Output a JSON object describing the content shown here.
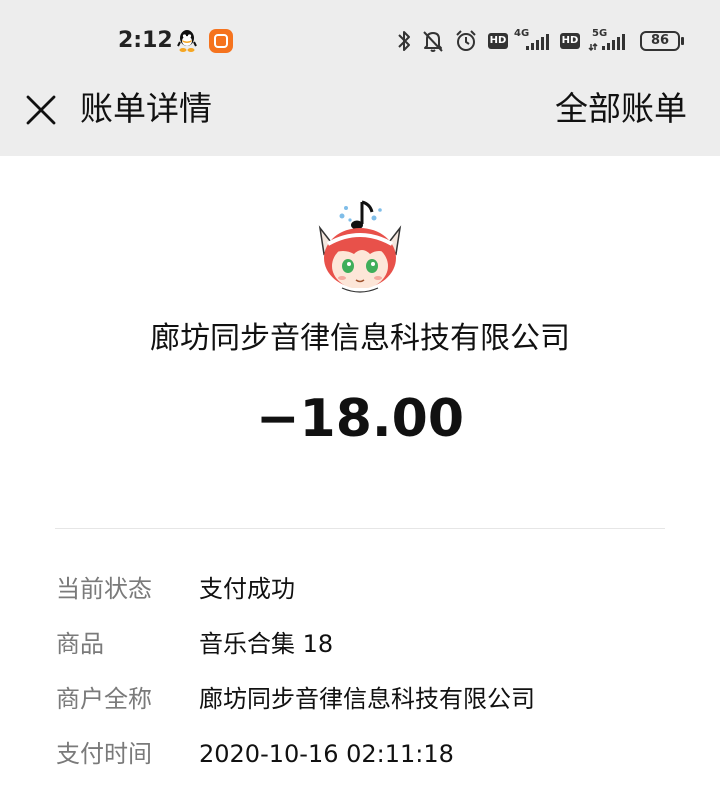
{
  "status_bar": {
    "time": "2:12",
    "network_1": "4G",
    "network_2": "5G",
    "hd_label": "HD",
    "battery": "86"
  },
  "nav": {
    "title": "账单详情",
    "all_bills": "全部账单"
  },
  "bill": {
    "merchant": "廊坊同步音律信息科技有限公司",
    "amount": "−18.00"
  },
  "details": [
    {
      "label": "当前状态",
      "value": "支付成功"
    },
    {
      "label": "商品",
      "value": "音乐合集 18"
    },
    {
      "label": "商户全称",
      "value": "廊坊同步音律信息科技有限公司"
    },
    {
      "label": "支付时间",
      "value": "2020-10-16 02:11:18"
    }
  ],
  "colors": {
    "header_bg": "#ededed",
    "label_gray": "#7a7a7a",
    "mi_orange": "#f5731e"
  }
}
